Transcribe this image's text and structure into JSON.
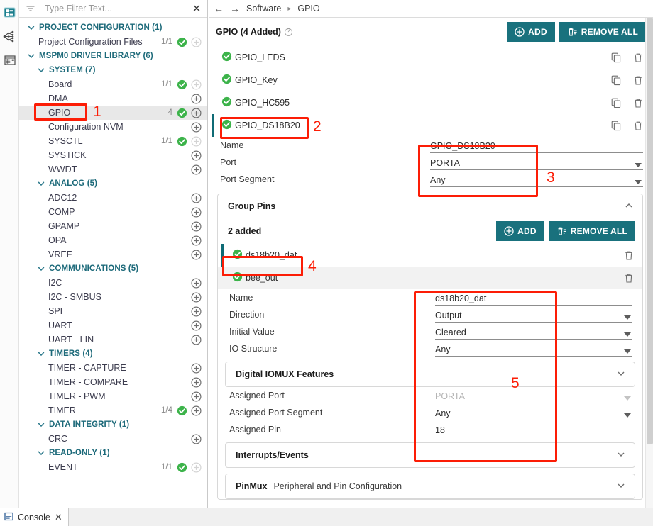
{
  "sidebar": {
    "filter": {
      "placeholder": "Type Filter Text...",
      "value": "",
      "clear_label": "✕"
    },
    "tree": [
      {
        "level": 0,
        "label": "PROJECT CONFIGURATION (1)",
        "type": "category",
        "expanded": true
      },
      {
        "level": 1,
        "label": "Project Configuration Files",
        "type": "leaf",
        "ratio": "1/1",
        "checked": true,
        "plus_disabled": true
      },
      {
        "level": 0,
        "label": "MSPM0 DRIVER LIBRARY (6)",
        "type": "category",
        "expanded": true
      },
      {
        "level": 1,
        "label": "SYSTEM (7)",
        "type": "category",
        "expanded": true
      },
      {
        "level": 2,
        "label": "Board",
        "type": "leaf",
        "ratio": "1/1",
        "checked": true,
        "plus_disabled": true
      },
      {
        "level": 2,
        "label": "DMA",
        "type": "leaf",
        "ratio": "",
        "checked": false
      },
      {
        "level": 2,
        "label": "GPIO",
        "type": "leaf",
        "ratio": "4",
        "checked": true,
        "selected": true
      },
      {
        "level": 2,
        "label": "Configuration NVM",
        "type": "leaf",
        "ratio": "",
        "checked": false
      },
      {
        "level": 2,
        "label": "SYSCTL",
        "type": "leaf",
        "ratio": "1/1",
        "checked": true,
        "plus_disabled": true
      },
      {
        "level": 2,
        "label": "SYSTICK",
        "type": "leaf",
        "ratio": "",
        "checked": false
      },
      {
        "level": 2,
        "label": "WWDT",
        "type": "leaf",
        "ratio": "",
        "checked": false
      },
      {
        "level": 1,
        "label": "ANALOG (5)",
        "type": "category",
        "expanded": true
      },
      {
        "level": 2,
        "label": "ADC12",
        "type": "leaf",
        "ratio": "",
        "checked": false
      },
      {
        "level": 2,
        "label": "COMP",
        "type": "leaf",
        "ratio": "",
        "checked": false
      },
      {
        "level": 2,
        "label": "GPAMP",
        "type": "leaf",
        "ratio": "",
        "checked": false
      },
      {
        "level": 2,
        "label": "OPA",
        "type": "leaf",
        "ratio": "",
        "checked": false
      },
      {
        "level": 2,
        "label": "VREF",
        "type": "leaf",
        "ratio": "",
        "checked": false
      },
      {
        "level": 1,
        "label": "COMMUNICATIONS (5)",
        "type": "category",
        "expanded": true
      },
      {
        "level": 2,
        "label": "I2C",
        "type": "leaf",
        "ratio": "",
        "checked": false
      },
      {
        "level": 2,
        "label": "I2C - SMBUS",
        "type": "leaf",
        "ratio": "",
        "checked": false
      },
      {
        "level": 2,
        "label": "SPI",
        "type": "leaf",
        "ratio": "",
        "checked": false
      },
      {
        "level": 2,
        "label": "UART",
        "type": "leaf",
        "ratio": "",
        "checked": false
      },
      {
        "level": 2,
        "label": "UART - LIN",
        "type": "leaf",
        "ratio": "",
        "checked": false
      },
      {
        "level": 1,
        "label": "TIMERS (4)",
        "type": "category",
        "expanded": true
      },
      {
        "level": 2,
        "label": "TIMER - CAPTURE",
        "type": "leaf",
        "ratio": "",
        "checked": false
      },
      {
        "level": 2,
        "label": "TIMER - COMPARE",
        "type": "leaf",
        "ratio": "",
        "checked": false
      },
      {
        "level": 2,
        "label": "TIMER - PWM",
        "type": "leaf",
        "ratio": "",
        "checked": false
      },
      {
        "level": 2,
        "label": "TIMER",
        "type": "leaf",
        "ratio": "1/4",
        "checked": true
      },
      {
        "level": 1,
        "label": "DATA INTEGRITY (1)",
        "type": "category",
        "expanded": true
      },
      {
        "level": 2,
        "label": "CRC",
        "type": "leaf",
        "ratio": "",
        "checked": false
      },
      {
        "level": 1,
        "label": "READ-ONLY (1)",
        "type": "category",
        "expanded": true
      },
      {
        "level": 2,
        "label": "EVENT",
        "type": "leaf",
        "ratio": "1/1",
        "checked": true,
        "plus_disabled": true
      }
    ]
  },
  "breadcrumb": {
    "back_icon": "←",
    "forward_icon": "→",
    "items": [
      "Software",
      "GPIO"
    ],
    "separator": "▸"
  },
  "gpio_section": {
    "title": "GPIO (4 Added)",
    "help_icon": "?",
    "add_label": "ADD",
    "remove_all_label": "REMOVE ALL",
    "instances": [
      {
        "name": "GPIO_LEDS",
        "active": false
      },
      {
        "name": "GPIO_Key",
        "active": false
      },
      {
        "name": "GPIO_HC595",
        "active": false
      },
      {
        "name": "GPIO_DS18B20",
        "active": true
      }
    ]
  },
  "instance_form": {
    "rows": [
      {
        "label": "Name",
        "value": "GPIO_DS18B20",
        "type": "text"
      },
      {
        "label": "Port",
        "value": "PORTA",
        "type": "select"
      },
      {
        "label": "Port Segment",
        "value": "Any",
        "type": "select"
      }
    ]
  },
  "group_pins": {
    "title": "Group Pins",
    "collapse_icon": "chevron-up",
    "count_label": "2 added",
    "add_label": "ADD",
    "remove_all_label": "REMOVE ALL",
    "pins": [
      {
        "name": "ds18b20_dat",
        "active": true
      },
      {
        "name": "bee_out",
        "active": false
      }
    ]
  },
  "pin_form": {
    "rows": [
      {
        "label": "Name",
        "value": "ds18b20_dat",
        "type": "text"
      },
      {
        "label": "Direction",
        "value": "Output",
        "type": "select"
      },
      {
        "label": "Initial Value",
        "value": "Cleared",
        "type": "select"
      },
      {
        "label": "IO Structure",
        "value": "Any",
        "type": "select"
      }
    ]
  },
  "iomux": {
    "title": "Digital IOMUX Features",
    "expand_icon": "chevron-down",
    "rows": [
      {
        "label": "Assigned Port",
        "value": "PORTA",
        "type": "select",
        "disabled": true
      },
      {
        "label": "Assigned Port Segment",
        "value": "Any",
        "type": "select",
        "disabled": false
      },
      {
        "label": "Assigned Pin",
        "value": "18",
        "type": "text",
        "disabled": false
      }
    ]
  },
  "interrupts": {
    "title": "Interrupts/Events",
    "expand_icon": "chevron-down"
  },
  "pinmux": {
    "title": "PinMux",
    "subtitle": "Peripheral and Pin Configuration",
    "expand_icon": "chevron-down"
  },
  "annotations": [
    {
      "number": "1"
    },
    {
      "number": "2"
    },
    {
      "number": "3"
    },
    {
      "number": "4"
    },
    {
      "number": "5"
    }
  ],
  "console": {
    "label": "Console",
    "close_icon": "✕"
  },
  "colors": {
    "accent_teal": "#19717d",
    "annotation_red": "#fc1d06",
    "status_green": "#3cb34a",
    "category_text": "#1d6a7a"
  }
}
